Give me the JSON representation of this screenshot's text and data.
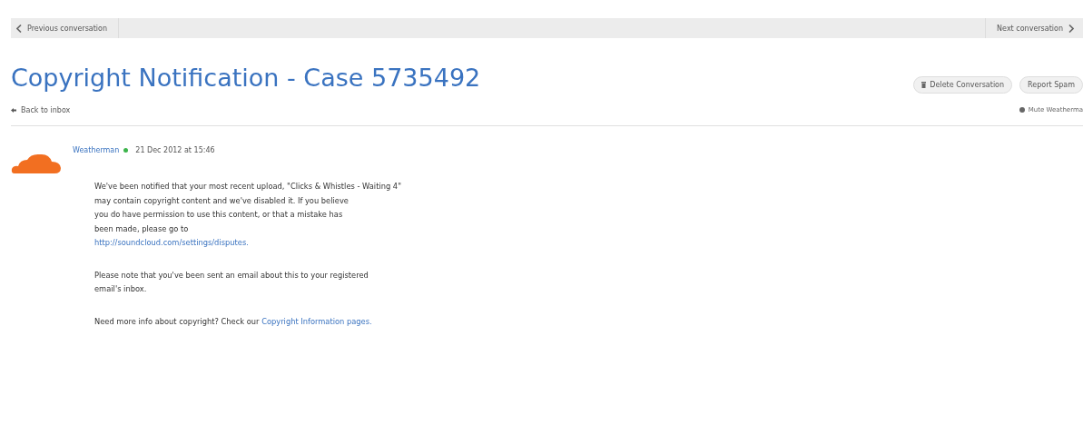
{
  "nav": {
    "previous": "Previous conversation",
    "next": "Next conversation"
  },
  "title": "Copyright Notification - Case 5735492",
  "back": "Back to inbox",
  "actions": {
    "delete": "Delete Conversation",
    "report": "Report Spam",
    "mute": "Mute Weatherma"
  },
  "message": {
    "sender": "Weatherman",
    "online": true,
    "date": "21 Dec 2012 at 15:46",
    "paragraphs": [
      {
        "lines": [
          "We've been notified that your most recent upload, \"Clicks & Whistles - Waiting 4\"",
          "may contain copyright content and we've disabled it. If you believe",
          "you do have permission to use this content, or that a mistake has",
          "been made, please go to"
        ],
        "link": "http://soundcloud.com/settings/disputes."
      },
      {
        "lines": [
          "Please note that you've been sent an email about this to your registered",
          "email's inbox."
        ]
      },
      {
        "lines": [
          "Need more info about copyright? Check our "
        ],
        "link": "Copyright Information pages."
      }
    ]
  }
}
